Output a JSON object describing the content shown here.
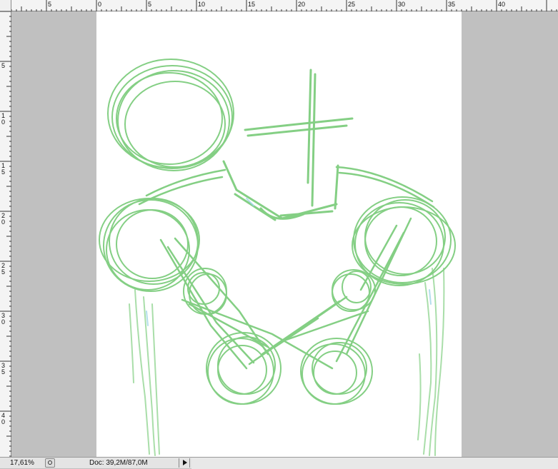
{
  "rulers": {
    "horizontal_labels": [
      "5",
      "0",
      "5",
      "10",
      "15",
      "20",
      "25",
      "30",
      "35",
      "40"
    ],
    "vertical_labels": [
      "5",
      "10",
      "15",
      "20",
      "25",
      "30",
      "35",
      "40"
    ]
  },
  "canvas": {
    "background": "#ffffff",
    "stroke_color": "#5cbf5c",
    "content": "green pencil sketch of a robot torso"
  },
  "status_bar": {
    "zoom": "17,61%",
    "doc_info": "Doc: 39,2M/87,0M",
    "menu_icon": "status-menu-icon",
    "play_icon": "play-arrow-icon"
  }
}
